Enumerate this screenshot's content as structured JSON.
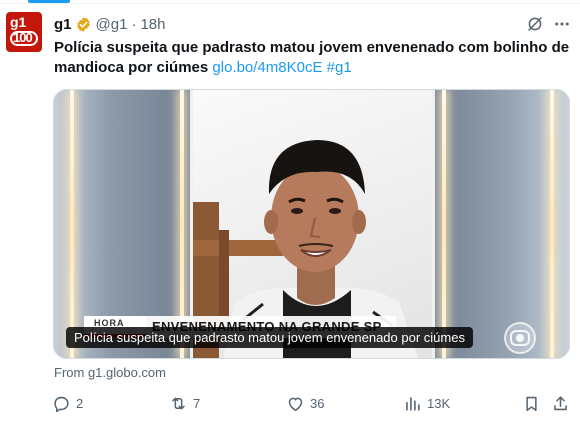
{
  "tweet": {
    "author": {
      "name": "g1",
      "handle": "@g1",
      "time": "18h",
      "verified": true,
      "avatar_text": "g1",
      "avatar_badge": "100",
      "brand_color": "#c4170c"
    },
    "text": {
      "title": "Polícia suspeita que padrasto matou jovem envenenado com bolinho de mandioca por ciúmes",
      "link": "glo.bo/4m8K0cE",
      "hashtag": "#g1"
    },
    "media": {
      "lower_third_tag": "HORA",
      "lower_third_headline": "ENVENENAMENTO NA GRANDE SP",
      "caption": "Polícia suspeita que padrasto matou jovem envenenado por ciúmes"
    },
    "source": "From g1.globo.com",
    "actions": {
      "replies": "2",
      "reposts": "7",
      "likes": "36",
      "views": "13K"
    },
    "icons": {
      "grok": "grok-icon",
      "more": "more-icon",
      "reply": "reply-icon",
      "repost": "repost-icon",
      "like": "like-icon",
      "views": "views-icon",
      "bookmark": "bookmark-icon",
      "share": "share-icon"
    },
    "colors": {
      "link": "#1d9bf0",
      "text": "#0f1419",
      "muted": "#536471",
      "verified_badge": "#e6a817"
    }
  }
}
